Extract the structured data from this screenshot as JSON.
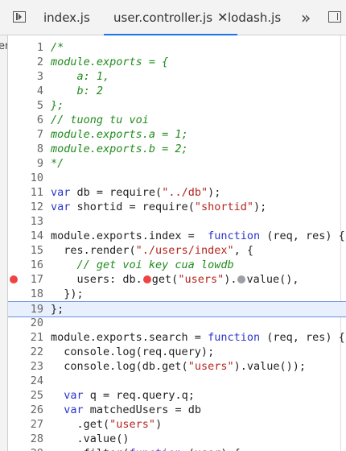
{
  "tabs": [
    {
      "label": "index.js",
      "active": false
    },
    {
      "label": "user.controller.js",
      "active": true
    },
    {
      "label": "lodash.js",
      "active": false
    }
  ],
  "close_glyph": "✕",
  "overflow_glyph": "»",
  "left_panel_label": "er",
  "icons": {
    "navigator_toggle": "sidebar-left-icon",
    "debugger_toggle": "sidebar-right-icon",
    "breakpoint": "breakpoint-marker-icon"
  },
  "colors": {
    "comment": "#208b1c",
    "keyword": "#2b36c9",
    "string": "#b3261e",
    "breakpoint": "#ee4444",
    "selection": "#e8f0fe",
    "accent": "#1a73e8"
  },
  "highlighted_line": 19,
  "breakpoint_lines": [
    17
  ],
  "lines": [
    {
      "n": "1",
      "t": [
        {
          "c": "cm",
          "s": "/*"
        }
      ]
    },
    {
      "n": "2",
      "t": [
        {
          "c": "cm",
          "s": "module.exports = {"
        }
      ]
    },
    {
      "n": "3",
      "t": [
        {
          "c": "cm",
          "s": "    a: 1,"
        }
      ]
    },
    {
      "n": "4",
      "t": [
        {
          "c": "cm",
          "s": "    b: 2"
        }
      ]
    },
    {
      "n": "5",
      "t": [
        {
          "c": "cm",
          "s": "};"
        }
      ]
    },
    {
      "n": "6",
      "t": [
        {
          "c": "cm",
          "s": "// tuong tu voi"
        }
      ]
    },
    {
      "n": "7",
      "t": [
        {
          "c": "cm",
          "s": "module.exports.a = 1;"
        }
      ]
    },
    {
      "n": "8",
      "t": [
        {
          "c": "cm",
          "s": "module.exports.b = 2;"
        }
      ]
    },
    {
      "n": "9",
      "t": [
        {
          "c": "cm",
          "s": "*/"
        }
      ]
    },
    {
      "n": "10",
      "t": []
    },
    {
      "n": "11",
      "t": [
        {
          "c": "kw",
          "s": "var"
        },
        {
          "c": "",
          "s": " db = require("
        },
        {
          "c": "st",
          "s": "\"../db\""
        },
        {
          "c": "",
          "s": ");"
        }
      ]
    },
    {
      "n": "12",
      "t": [
        {
          "c": "kw",
          "s": "var"
        },
        {
          "c": "",
          "s": " shortid = require("
        },
        {
          "c": "st",
          "s": "\"shortid\""
        },
        {
          "c": "",
          "s": ");"
        }
      ]
    },
    {
      "n": "13",
      "t": []
    },
    {
      "n": "14",
      "t": [
        {
          "c": "",
          "s": "module.exports.index =  "
        },
        {
          "c": "kw",
          "s": "function"
        },
        {
          "c": "",
          "s": " (req, res) {"
        }
      ]
    },
    {
      "n": "15",
      "t": [
        {
          "c": "",
          "s": "  res.render("
        },
        {
          "c": "st",
          "s": "\"./users/index\""
        },
        {
          "c": "",
          "s": ", {"
        }
      ]
    },
    {
      "n": "16",
      "t": [
        {
          "c": "cm",
          "s": "    // get voi key cua lowdb"
        }
      ]
    },
    {
      "n": "17",
      "t": [
        {
          "c": "",
          "s": "    users: db."
        },
        {
          "c": "dot-red",
          "s": ""
        },
        {
          "c": "",
          "s": "get("
        },
        {
          "c": "st",
          "s": "\"users\""
        },
        {
          "c": "",
          "s": ")."
        },
        {
          "c": "dot-gray",
          "s": ""
        },
        {
          "c": "",
          "s": "value(),"
        }
      ]
    },
    {
      "n": "18",
      "t": [
        {
          "c": "",
          "s": "  });"
        }
      ]
    },
    {
      "n": "19",
      "t": [
        {
          "c": "",
          "s": "};"
        }
      ]
    },
    {
      "n": "20",
      "t": []
    },
    {
      "n": "21",
      "t": [
        {
          "c": "",
          "s": "module.exports.search = "
        },
        {
          "c": "kw",
          "s": "function"
        },
        {
          "c": "",
          "s": " (req, res) {"
        }
      ]
    },
    {
      "n": "22",
      "t": [
        {
          "c": "",
          "s": "  console.log(req.query);"
        }
      ]
    },
    {
      "n": "23",
      "t": [
        {
          "c": "",
          "s": "  console.log(db.get("
        },
        {
          "c": "st",
          "s": "\"users\""
        },
        {
          "c": "",
          "s": ").value());"
        }
      ]
    },
    {
      "n": "24",
      "t": []
    },
    {
      "n": "25",
      "t": [
        {
          "c": "",
          "s": "  "
        },
        {
          "c": "kw",
          "s": "var"
        },
        {
          "c": "",
          "s": " q = req.query.q;"
        }
      ]
    },
    {
      "n": "26",
      "t": [
        {
          "c": "",
          "s": "  "
        },
        {
          "c": "kw",
          "s": "var"
        },
        {
          "c": "",
          "s": " matchedUsers = db"
        }
      ]
    },
    {
      "n": "27",
      "t": [
        {
          "c": "",
          "s": "    .get("
        },
        {
          "c": "st",
          "s": "\"users\""
        },
        {
          "c": "",
          "s": ")"
        }
      ]
    },
    {
      "n": "28",
      "t": [
        {
          "c": "",
          "s": "    .value()"
        }
      ]
    },
    {
      "n": "29",
      "t": [
        {
          "c": "",
          "s": "    .filter("
        },
        {
          "c": "kw",
          "s": "function"
        },
        {
          "c": "",
          "s": " (user) {"
        }
      ]
    }
  ]
}
